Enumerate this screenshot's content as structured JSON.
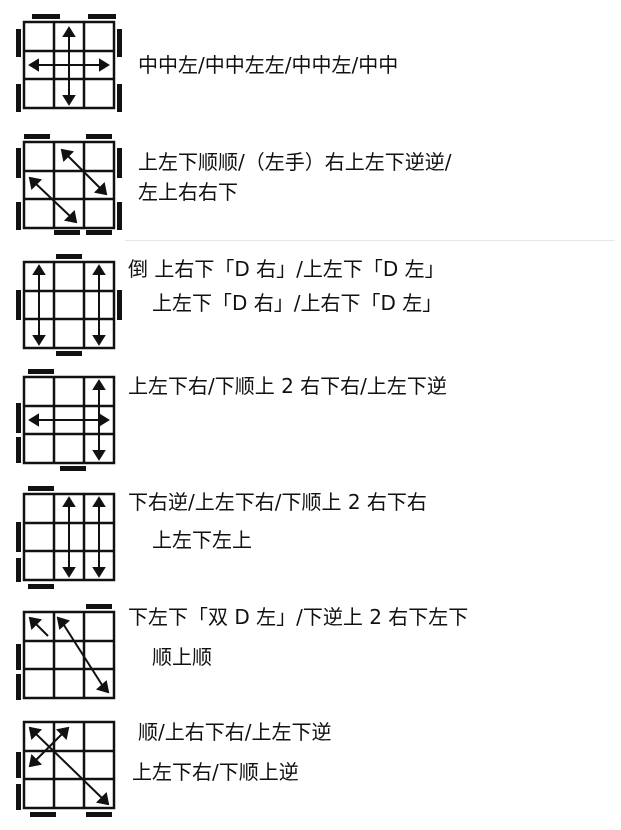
{
  "cases": [
    {
      "id": "case-1",
      "lines": [
        "中中左/中中左左/中中左/中中"
      ]
    },
    {
      "id": "case-2",
      "lines": [
        "上左下顺顺/（左手）右上左下逆逆/",
        "左上右右下"
      ]
    },
    {
      "id": "case-3",
      "lines": [
        "倒 上右下「D 右」/上左下「D 左」",
        "上左下「D 右」/上右下「D 左」"
      ]
    },
    {
      "id": "case-4",
      "lines": [
        "上左下右/下顺上 2 右下右/上左下逆"
      ]
    },
    {
      "id": "case-5",
      "lines": [
        "下右逆/上左下右/下顺上 2 右下右",
        "上左下左上"
      ]
    },
    {
      "id": "case-6",
      "lines": [
        "下左下「双 D 左」/下逆上 2 右下左下",
        "顺上顺"
      ]
    },
    {
      "id": "case-7",
      "lines": [
        "顺/上右下右/上左下逆",
        "上左下右/下顺上逆"
      ]
    }
  ],
  "colors": {
    "ink": "#111111",
    "separator": "#e6e6e6"
  },
  "icon_names": [
    "cube-top-face-icon",
    "arrow-icon",
    "edge-bar-icon"
  ]
}
